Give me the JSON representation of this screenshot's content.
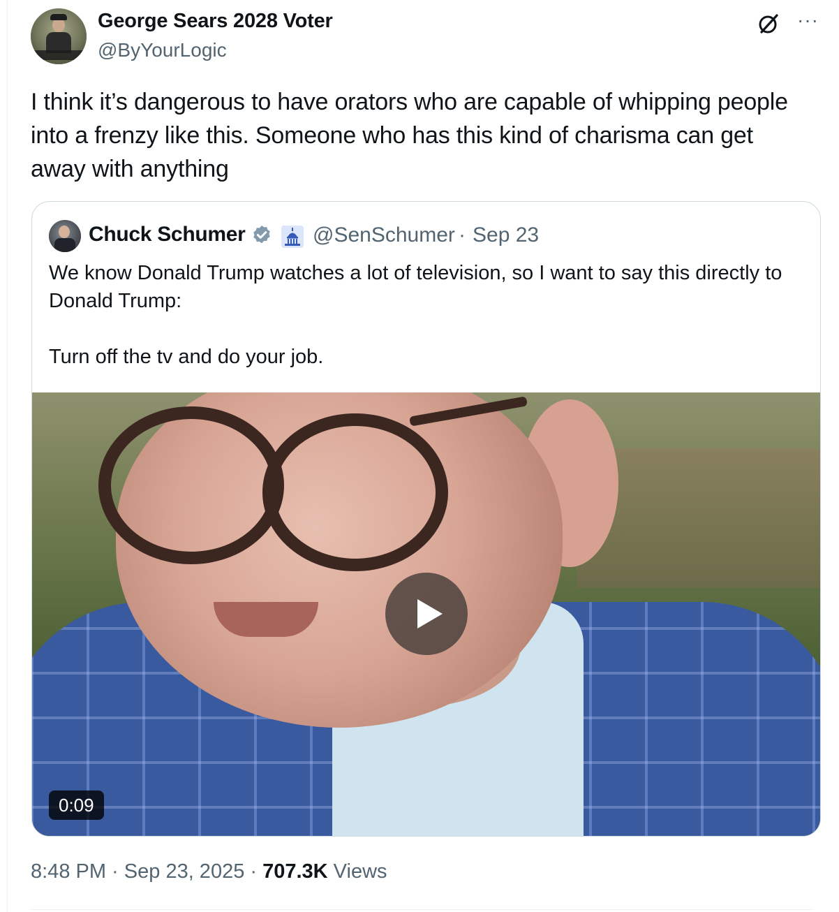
{
  "author": {
    "display_name": "George Sears 2028 Voter",
    "handle": "@ByYourLogic"
  },
  "icons": {
    "grok": "grok-icon",
    "more": "more-options-icon",
    "more_glyph": "···",
    "verified": "verified-badge-icon",
    "affiliate": "capitol-building-icon",
    "play": "play-icon"
  },
  "tweet": {
    "text": "I think it’s dangerous to have orators who are capable of whipping people into a frenzy like this. Someone who has this kind of charisma can get away with anything"
  },
  "quoted": {
    "display_name": "Chuck Schumer",
    "handle": "@SenSchumer",
    "separator": "·",
    "date": "Sep 23",
    "text_line1": "We know Donald Trump watches a lot of television, so I want to say this directly to Donald Trump:",
    "text_line2": "Turn off the tv and do your job.",
    "video_duration": "0:09"
  },
  "meta": {
    "time": "8:48 PM",
    "sep1": " · ",
    "date": "Sep 23, 2025",
    "sep2": " · ",
    "views_count": "707.3K",
    "views_label": " Views"
  },
  "colors": {
    "text_primary": "#0f1419",
    "text_secondary": "#536471",
    "border": "#cfd9de",
    "verified_blue": "#1d9bf0"
  }
}
